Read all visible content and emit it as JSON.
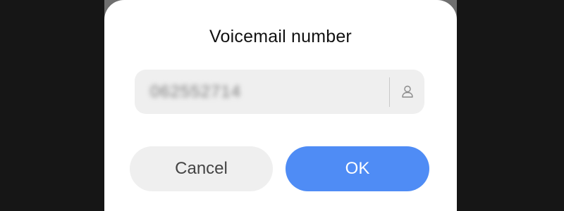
{
  "dialog": {
    "title": "Voicemail number",
    "input": {
      "value": "062552714",
      "value_blurred": true,
      "contact_icon": "person-icon"
    },
    "buttons": {
      "cancel_label": "Cancel",
      "ok_label": "OK"
    }
  },
  "colors": {
    "ok_button": "#4f8cf5",
    "cancel_button": "#efefef",
    "input_background": "#efefef",
    "backdrop": "#161616"
  }
}
